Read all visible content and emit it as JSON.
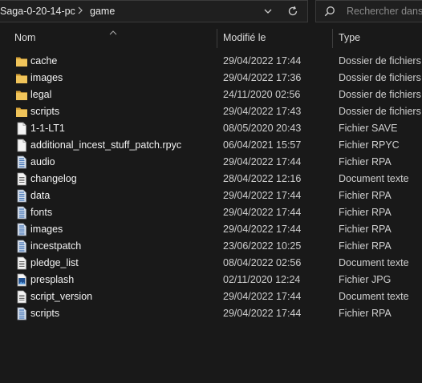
{
  "address": {
    "crumbs": [
      "Saga-0-20-14-pc",
      "game"
    ]
  },
  "search": {
    "placeholder": "Rechercher dans"
  },
  "columns": {
    "name": "Nom",
    "modified": "Modifié le",
    "type": "Type"
  },
  "files": [
    {
      "name": "cache",
      "modified": "29/04/2022 17:44",
      "type": "Dossier de fichiers",
      "icon": "folder-icon"
    },
    {
      "name": "images",
      "modified": "29/04/2022 17:36",
      "type": "Dossier de fichiers",
      "icon": "folder-icon"
    },
    {
      "name": "legal",
      "modified": "24/11/2020 02:56",
      "type": "Dossier de fichiers",
      "icon": "folder-icon"
    },
    {
      "name": "scripts",
      "modified": "29/04/2022 17:43",
      "type": "Dossier de fichiers",
      "icon": "folder-icon"
    },
    {
      "name": "1-1-LT1",
      "modified": "08/05/2020 20:43",
      "type": "Fichier SAVE",
      "icon": "blank-file-icon"
    },
    {
      "name": "additional_incest_stuff_patch.rpyc",
      "modified": "06/04/2021 15:57",
      "type": "Fichier RPYC",
      "icon": "blank-file-icon"
    },
    {
      "name": "audio",
      "modified": "29/04/2022 17:44",
      "type": "Fichier RPA",
      "icon": "archive-file-icon"
    },
    {
      "name": "changelog",
      "modified": "28/04/2022 12:16",
      "type": "Document texte",
      "icon": "text-file-icon"
    },
    {
      "name": "data",
      "modified": "29/04/2022 17:44",
      "type": "Fichier RPA",
      "icon": "archive-file-icon"
    },
    {
      "name": "fonts",
      "modified": "29/04/2022 17:44",
      "type": "Fichier RPA",
      "icon": "archive-file-icon"
    },
    {
      "name": "images",
      "modified": "29/04/2022 17:44",
      "type": "Fichier RPA",
      "icon": "archive-file-icon"
    },
    {
      "name": "incestpatch",
      "modified": "23/06/2022 10:25",
      "type": "Fichier RPA",
      "icon": "archive-file-icon"
    },
    {
      "name": "pledge_list",
      "modified": "08/04/2022 02:56",
      "type": "Document texte",
      "icon": "text-file-icon"
    },
    {
      "name": "presplash",
      "modified": "02/11/2020 12:24",
      "type": "Fichier JPG",
      "icon": "image-file-icon"
    },
    {
      "name": "script_version",
      "modified": "29/04/2022 17:44",
      "type": "Document texte",
      "icon": "text-file-icon"
    },
    {
      "name": "scripts",
      "modified": "29/04/2022 17:44",
      "type": "Fichier RPA",
      "icon": "archive-file-icon"
    }
  ],
  "colors": {
    "background": "#191919",
    "folder": "#e8b84a",
    "text": "#f2f2f2",
    "muted": "#cfcfcf"
  }
}
